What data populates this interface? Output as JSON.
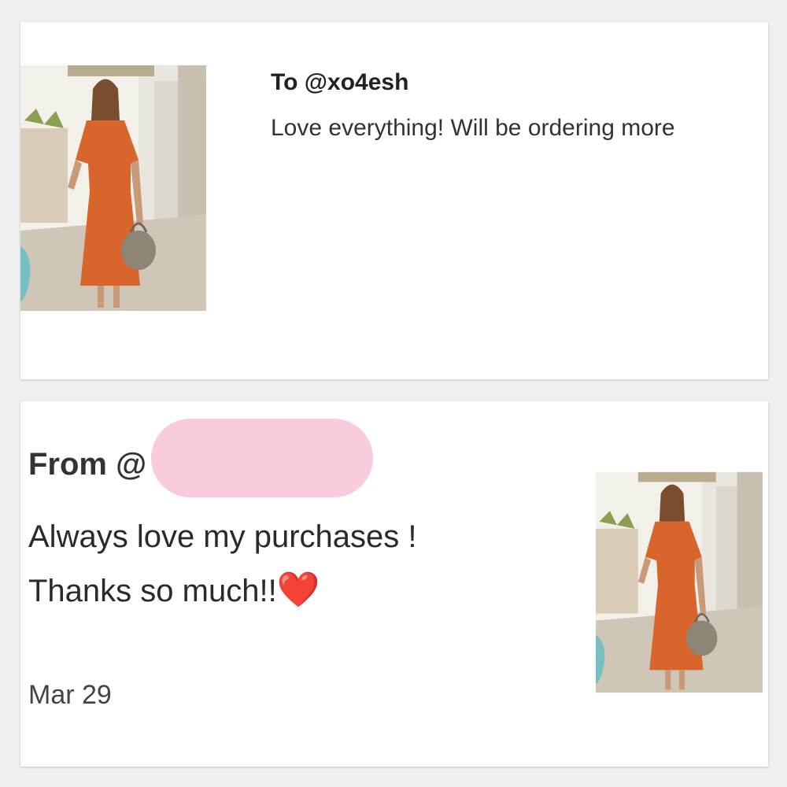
{
  "sent_review": {
    "recipient": "To @xo4esh",
    "message": "Love everything! Will be ordering more",
    "photo": "product-photo-floral-dress"
  },
  "received_review": {
    "sender_prefix": "From @",
    "message": "Always love my purchases ! Thanks so much!!",
    "emoji": "❤️",
    "date": "Mar 29",
    "photo": "product-photo-floral-dress"
  },
  "colors": {
    "redaction": "#f8ccde",
    "heart": "#e0161b"
  }
}
